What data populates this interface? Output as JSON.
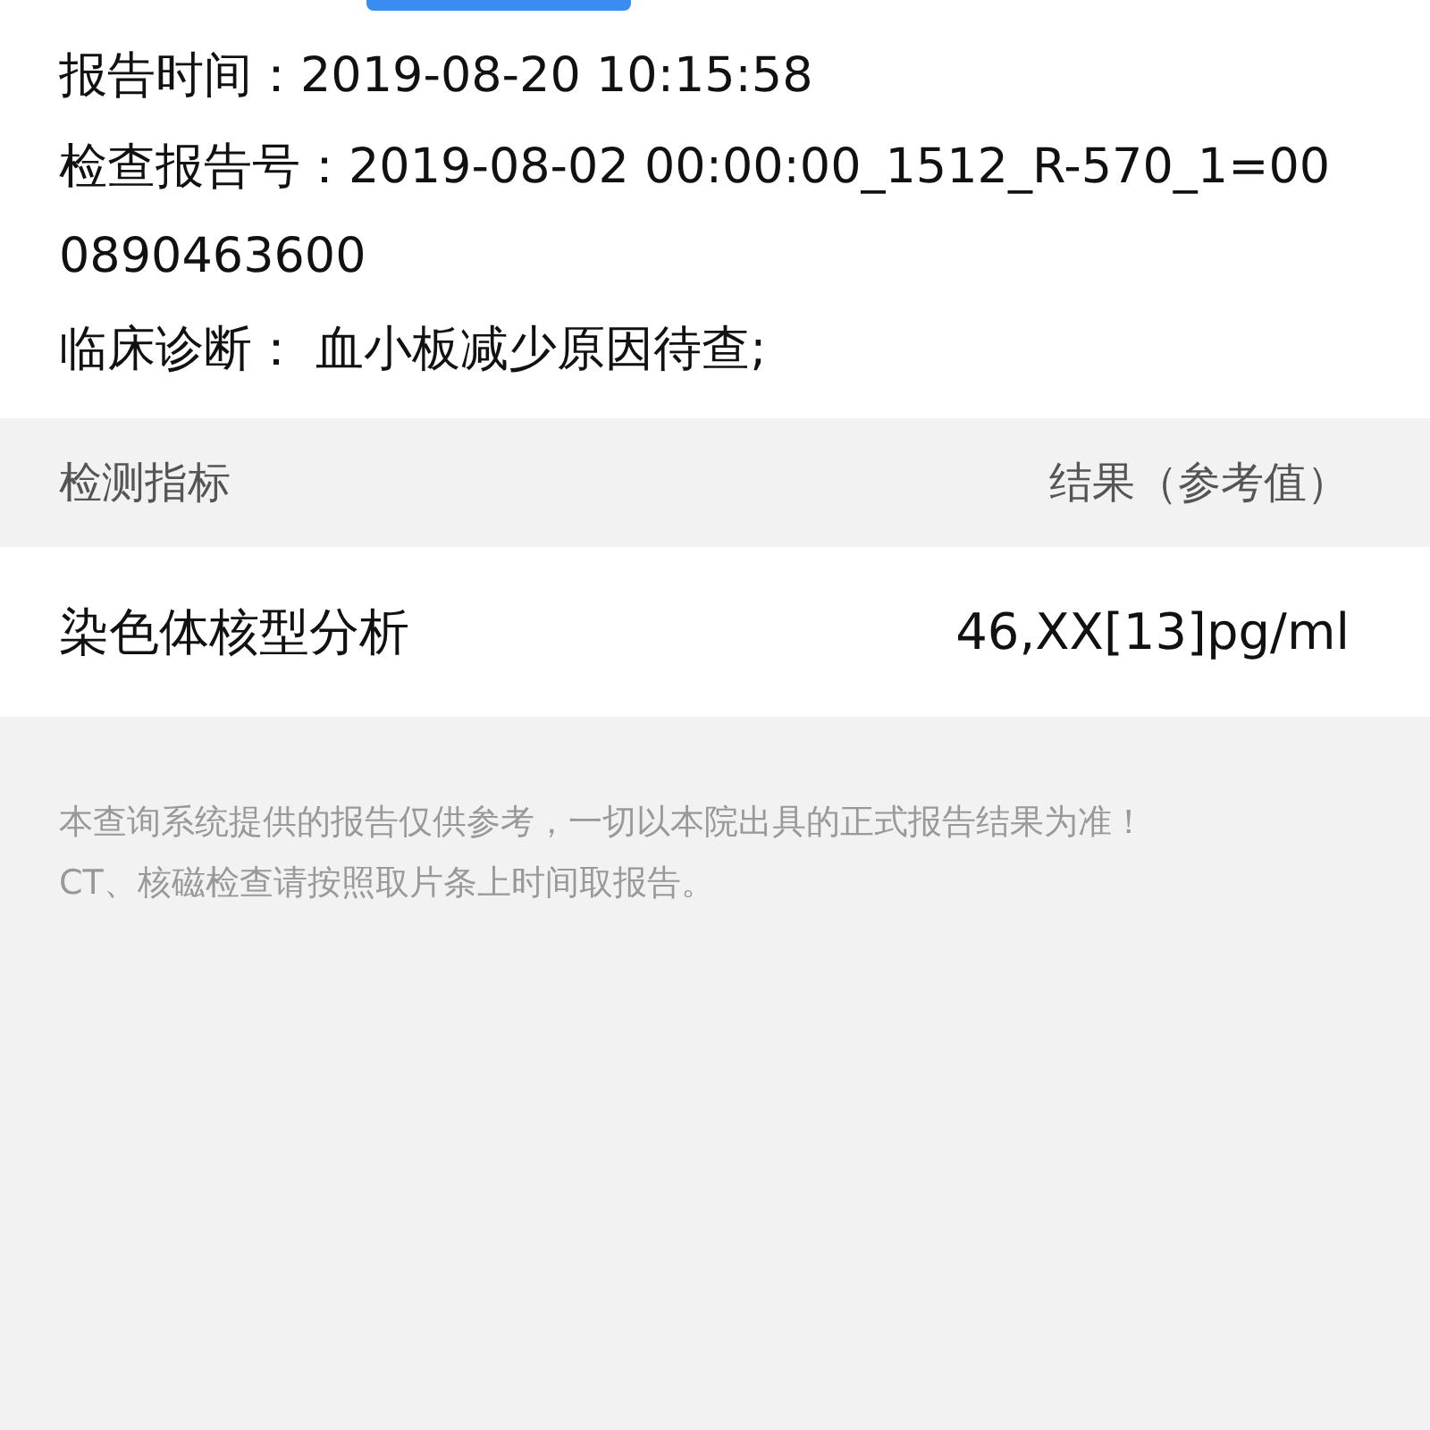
{
  "info_lines": [
    {
      "label": "报告时间：",
      "value": "2019-08-20 10:15:58"
    },
    {
      "label": "检查报告号：",
      "value": "2019-08-02 00:00:00_1512_R-570_1=000890463600"
    },
    {
      "label": "临床诊断：",
      "value": " 血小板减少原因待查;"
    }
  ],
  "table": {
    "columns": [
      "检测指标",
      "结果（参考值）"
    ],
    "rows": [
      {
        "name": "染色体核型分析",
        "result": "46,XX[13]pg/ml"
      }
    ]
  },
  "notes": [
    "本查询系统提供的报告仅供参考，一切以本院出具的正式报告结果为准！",
    "CT、核磁检查请按照取片条上时间取报告。"
  ]
}
